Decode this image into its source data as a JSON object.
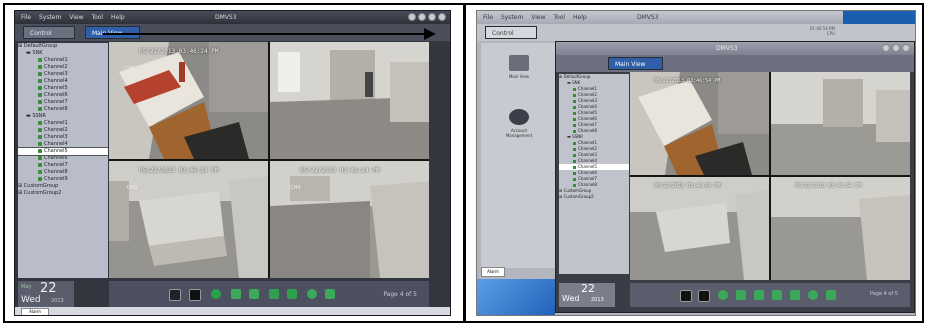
{
  "left": {
    "menu": [
      "File",
      "System",
      "View",
      "Tool",
      "Help"
    ],
    "app_title": "DMVS3",
    "tabs": {
      "control_panel": "Control Panel",
      "main_view": "Main View"
    },
    "tree": [
      {
        "label": "DefaultGroup",
        "level": 0
      },
      {
        "label": "SNK",
        "level": 1
      },
      {
        "label": "Channel1",
        "level": 2
      },
      {
        "label": "Channel2",
        "level": 2
      },
      {
        "label": "Channel3",
        "level": 2
      },
      {
        "label": "Channel4",
        "level": 2
      },
      {
        "label": "Channel5",
        "level": 2
      },
      {
        "label": "Channel6",
        "level": 2
      },
      {
        "label": "Channel7",
        "level": 2
      },
      {
        "label": "Channel8",
        "level": 2
      },
      {
        "label": "SSNR",
        "level": 1
      },
      {
        "label": "Channel1",
        "level": 2
      },
      {
        "label": "Channel2",
        "level": 2
      },
      {
        "label": "Channel3",
        "level": 2
      },
      {
        "label": "Channel4",
        "level": 2
      },
      {
        "label": "Channel5",
        "level": 2,
        "selected": true
      },
      {
        "label": "Channel6",
        "level": 2
      },
      {
        "label": "Channel7",
        "level": 2
      },
      {
        "label": "Channel8",
        "level": 2
      },
      {
        "label": "Channel9",
        "level": 2
      },
      {
        "label": "CustomGroup",
        "level": 0
      },
      {
        "label": "CustomGroup2",
        "level": 0
      }
    ],
    "cameras": [
      {
        "stamp": "05/22/2013 03:46:24 PM",
        "label": "CH1"
      },
      {
        "stamp": "",
        "label": "CH2"
      },
      {
        "stamp": "05/22/2013 03:46:24 PM",
        "label": "CH3"
      },
      {
        "stamp": "05/22/2013 03:46:24 PM",
        "label": "CH4"
      }
    ],
    "date": {
      "month": "May",
      "day": "22",
      "weekday": "Wed",
      "year": "2013"
    },
    "page_info": "Page 4 of 5",
    "alarm_label": "Alarm"
  },
  "right": {
    "menu": [
      "File",
      "System",
      "View",
      "Tool",
      "Help"
    ],
    "app_title": "DMVS3",
    "tabs": {
      "control_panel": "Control Panel",
      "main_view": "Main View"
    },
    "header_info": [
      "01:46:54 PM",
      "CPU"
    ],
    "icons": [
      "Main View",
      "Account Management"
    ],
    "tree": [
      {
        "label": "DefaultGroup",
        "level": 0
      },
      {
        "label": "SNK",
        "level": 1
      },
      {
        "label": "Channel1",
        "level": 2
      },
      {
        "label": "Channel2",
        "level": 2
      },
      {
        "label": "Channel3",
        "level": 2
      },
      {
        "label": "Channel4",
        "level": 2
      },
      {
        "label": "Channel5",
        "level": 2
      },
      {
        "label": "Channel6",
        "level": 2
      },
      {
        "label": "Channel7",
        "level": 2
      },
      {
        "label": "Channel8",
        "level": 2
      },
      {
        "label": "SSNR",
        "level": 1
      },
      {
        "label": "Channel1",
        "level": 2
      },
      {
        "label": "Channel2",
        "level": 2
      },
      {
        "label": "Channel3",
        "level": 2
      },
      {
        "label": "Channel4",
        "level": 2
      },
      {
        "label": "Channel5",
        "level": 2,
        "selected": true
      },
      {
        "label": "Channel6",
        "level": 2
      },
      {
        "label": "Channel7",
        "level": 2
      },
      {
        "label": "Channel8",
        "level": 2
      },
      {
        "label": "CustomGroup",
        "level": 0
      },
      {
        "label": "CustomGroup2",
        "level": 0
      }
    ],
    "cameras": [
      {
        "stamp": "05/22/2013 03:46:54 PM",
        "label": "CH1"
      },
      {
        "stamp": "",
        "label": "CH2"
      },
      {
        "stamp": "05/22/2013 03:46:54 PM",
        "label": "CH3"
      },
      {
        "stamp": "05/22/2013 03:46:54 PM",
        "label": "CH4"
      }
    ],
    "date": {
      "day": "22",
      "weekday": "Wed",
      "year": "2013"
    },
    "page_info": "Page 4 of 5",
    "alarm_label": "Alarm"
  },
  "colors": {
    "accent": "#2f5fa8",
    "panel_dark": "#34363f",
    "tree_bg": "#b9bdc9"
  }
}
